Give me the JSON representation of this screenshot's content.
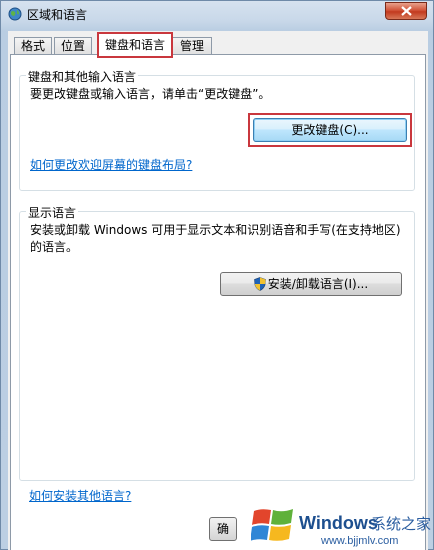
{
  "window": {
    "title": "区域和语言",
    "icon": "globe-icon",
    "close_icon": "close-icon"
  },
  "tabs": [
    {
      "label": "格式"
    },
    {
      "label": "位置"
    },
    {
      "label": "键盘和语言",
      "active": true
    },
    {
      "label": "管理"
    }
  ],
  "keyboard_group": {
    "title": "键盘和其他输入语言",
    "description": "要更改键盘或输入语言，请单击“更改键盘”。",
    "change_button": "更改键盘(C)...",
    "link": "如何更改欢迎屏幕的键盘布局?"
  },
  "display_group": {
    "title": "显示语言",
    "description": "安装或卸载 Windows 可用于显示文本和识别语音和手写(在支持地区)的语言。",
    "install_button": "安装/卸载语言(I)...",
    "install_icon": "shield-icon"
  },
  "footer": {
    "link": "如何安装其他语言?",
    "partial_button": "确"
  },
  "watermark": {
    "brand": "Windows",
    "suffix": "系统之家",
    "url": "www.bjjmlv.com"
  },
  "colors": {
    "highlight": "#c9373d",
    "link": "#0066cc",
    "titlebar": "#c8d8e9"
  }
}
